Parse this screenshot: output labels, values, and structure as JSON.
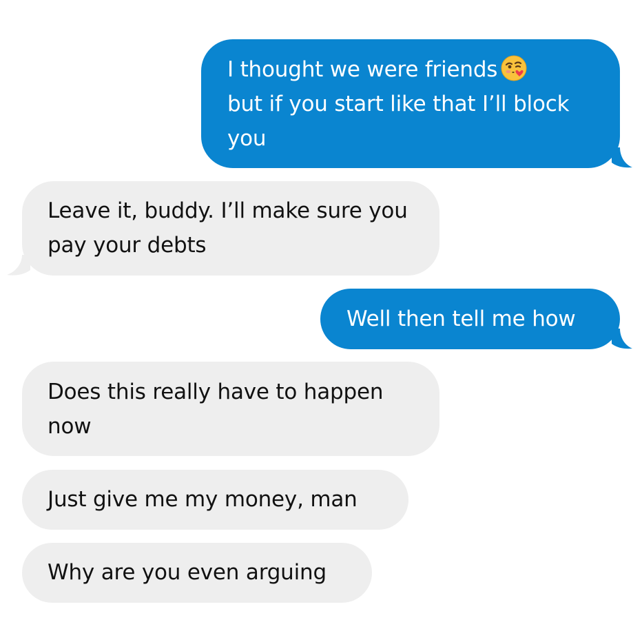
{
  "conversation": {
    "colors": {
      "sent_bubble": "#0a85d0",
      "sent_text": "#ffffff",
      "received_bubble": "#eeeeee",
      "received_text": "#111111",
      "background": "#ffffff"
    },
    "messages": [
      {
        "direction": "sent",
        "text": "I thought we were friends",
        "text_continued": "but if you start like that I’ll block you",
        "emoji": "face-blowing-a-kiss-emoji",
        "has_tail": true
      },
      {
        "direction": "received",
        "text": "Leave it, buddy. I’ll make sure you pay your debts",
        "has_tail": true
      },
      {
        "direction": "sent",
        "text": "Well then tell me how",
        "has_tail": true
      },
      {
        "direction": "received",
        "text": "Does this really have to happen now",
        "has_tail": false
      },
      {
        "direction": "received",
        "text": "Just give me my money, man",
        "has_tail": false
      },
      {
        "direction": "received",
        "text": "Why are you even arguing",
        "has_tail": false
      }
    ]
  }
}
